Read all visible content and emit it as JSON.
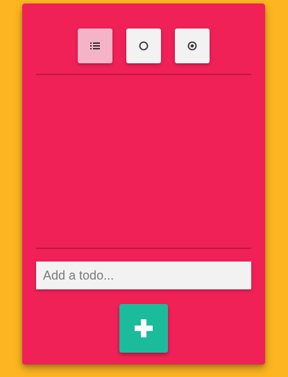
{
  "filters": [
    {
      "name": "all",
      "icon": "list-icon",
      "active": true
    },
    {
      "name": "active",
      "icon": "circle-outline-icon",
      "active": false
    },
    {
      "name": "completed",
      "icon": "radio-checked-icon",
      "active": false
    }
  ],
  "todo_input": {
    "placeholder": "Add a todo...",
    "value": ""
  },
  "add_button": {
    "icon": "plus-icon"
  },
  "todos": [],
  "colors": {
    "background": "#FDB621",
    "card": "#F02157",
    "divider": "#C4163F",
    "button": "#F2F2F2",
    "button_active": "#F4B3C6",
    "add_button": "#1ABC9C"
  }
}
